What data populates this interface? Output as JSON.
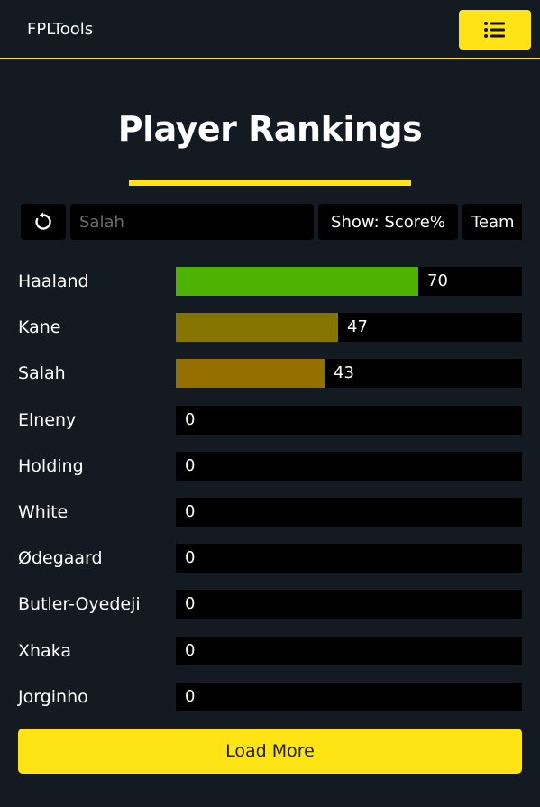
{
  "navbar": {
    "brand": "FPLTools",
    "menu_icon": "list-menu-icon",
    "accent_color": "#ffe415"
  },
  "page": {
    "title": "Player Rankings"
  },
  "toolbar": {
    "refresh_icon": "refresh-icon",
    "search_placeholder": "Salah",
    "search_value": "",
    "show_label": "Show: Score%",
    "team_label": "Team"
  },
  "rankings": {
    "max_value": 100,
    "players": [
      {
        "name": "Haaland",
        "value": 70,
        "value_label": "70",
        "color": "#4db300"
      },
      {
        "name": "Kane",
        "value": 47,
        "value_label": "47",
        "color": "#857500"
      },
      {
        "name": "Salah",
        "value": 43,
        "value_label": "43",
        "color": "#937000"
      },
      {
        "name": "Elneny",
        "value": 0,
        "value_label": "0",
        "color": "#000000"
      },
      {
        "name": "Holding",
        "value": 0,
        "value_label": "0",
        "color": "#000000"
      },
      {
        "name": "White",
        "value": 0,
        "value_label": "0",
        "color": "#000000"
      },
      {
        "name": "Ødegaard",
        "value": 0,
        "value_label": "0",
        "color": "#000000"
      },
      {
        "name": "Butler-Oyedeji",
        "value": 0,
        "value_label": "0",
        "color": "#000000"
      },
      {
        "name": "Xhaka",
        "value": 0,
        "value_label": "0",
        "color": "#000000"
      },
      {
        "name": "Jorginho",
        "value": 0,
        "value_label": "0",
        "color": "#000000"
      }
    ]
  },
  "load_more": {
    "label": "Load More"
  }
}
